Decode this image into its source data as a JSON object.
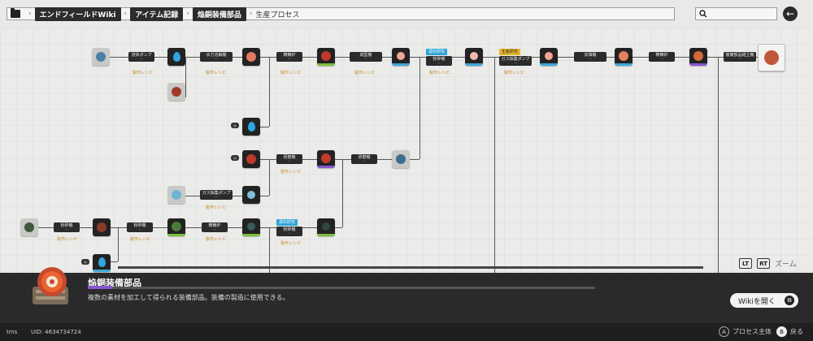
{
  "breadcrumb": {
    "items": [
      "エンドフィールドWiki",
      "アイテム記録",
      "焔銅装備部品"
    ],
    "current": "生産プロセス"
  },
  "colors": {
    "accent_purple": "#8a55d1",
    "accent_green": "#7bbf3c",
    "accent_blue": "#3fa8d8",
    "recipe_orange": "#c78b2c",
    "tag_yellow": "#e8b52a"
  },
  "graph": {
    "machines": [
      "流体ポンプ",
      "水力溶解機",
      "精錬炉",
      "成型機",
      "粉砕機",
      "ガス採集ポンプ",
      "充填機",
      "精錬炉",
      "研磨機",
      "研磨機",
      "装備部品組立機"
    ],
    "tags": [
      "源石研究",
      "生産研究",
      "源石研究",
      "製造研究"
    ],
    "recipe_label": "製作レシピ"
  },
  "zoom": {
    "lt": "LT",
    "rt": "RT",
    "label": "ズーム"
  },
  "detail": {
    "name": "焔銅装備部品",
    "description": "複数の素材を加工して得られる装備部品。装備の製造に使用できる。",
    "wiki_button": "Wikiを開く"
  },
  "footer": {
    "signal": "tms",
    "uid": "UID: 4634734724",
    "hint1_key": "A",
    "hint1_label": "プロセス主体",
    "hint2_key": "B",
    "hint2_label": "戻る"
  }
}
